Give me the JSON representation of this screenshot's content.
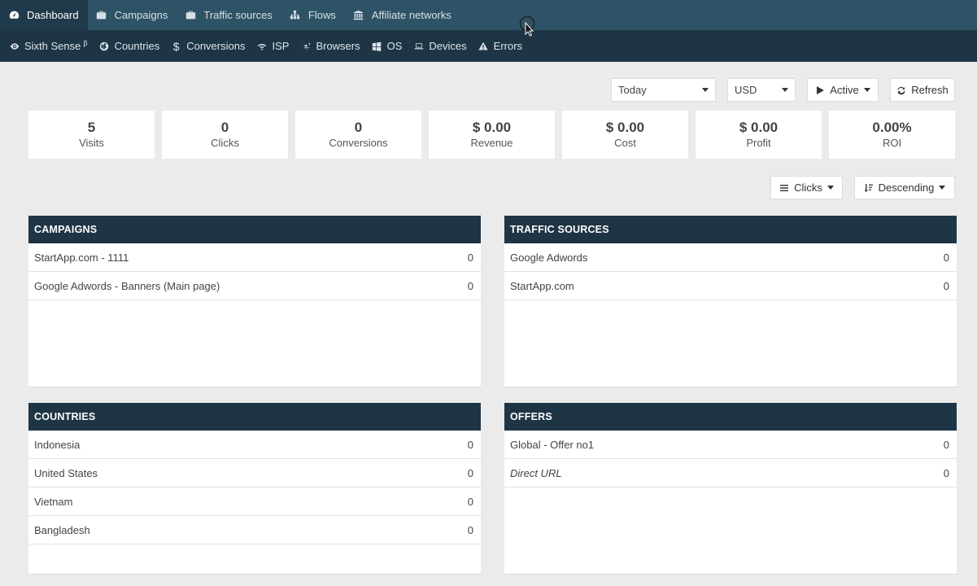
{
  "topnav": {
    "items": [
      {
        "label": "Dashboard",
        "icon": "dashboard-icon",
        "active": true
      },
      {
        "label": "Campaigns",
        "icon": "briefcase-icon"
      },
      {
        "label": "Traffic sources",
        "icon": "briefcase-icon"
      },
      {
        "label": "Flows",
        "icon": "sitemap-icon"
      },
      {
        "label": "Affiliate networks",
        "icon": "bank-icon"
      }
    ]
  },
  "subnav": {
    "items": [
      {
        "label": "Sixth Sense",
        "sup": "β",
        "icon": "eye-icon"
      },
      {
        "label": "Countries",
        "icon": "globe-icon"
      },
      {
        "label": "Conversions",
        "icon": "dollar-icon"
      },
      {
        "label": "ISP",
        "icon": "wifi-icon"
      },
      {
        "label": "Browsers",
        "icon": "browser-icon"
      },
      {
        "label": "OS",
        "icon": "windows-icon"
      },
      {
        "label": "Devices",
        "icon": "laptop-icon"
      },
      {
        "label": "Errors",
        "icon": "warning-icon"
      }
    ]
  },
  "controls": {
    "period": "Today",
    "currency": "USD",
    "status": "Active",
    "refresh": "Refresh",
    "sort_by": "Clicks",
    "sort_order": "Descending"
  },
  "stats": [
    {
      "value": "5",
      "label": "Visits"
    },
    {
      "value": "0",
      "label": "Clicks"
    },
    {
      "value": "0",
      "label": "Conversions"
    },
    {
      "value": "$ 0.00",
      "label": "Revenue"
    },
    {
      "value": "$ 0.00",
      "label": "Cost"
    },
    {
      "value": "$ 0.00",
      "label": "Profit"
    },
    {
      "value": "0.00%",
      "label": "ROI"
    }
  ],
  "panels": {
    "campaigns": {
      "title": "CAMPAIGNS",
      "rows": [
        {
          "name": "StartApp.com - 1111",
          "value": "0"
        },
        {
          "name": "Google Adwords - Banners (Main page)",
          "value": "0"
        }
      ]
    },
    "traffic_sources": {
      "title": "TRAFFIC SOURCES",
      "rows": [
        {
          "name": "Google Adwords",
          "value": "0"
        },
        {
          "name": "StartApp.com",
          "value": "0"
        }
      ]
    },
    "countries": {
      "title": "COUNTRIES",
      "rows": [
        {
          "name": "Indonesia",
          "value": "0"
        },
        {
          "name": "United States",
          "value": "0"
        },
        {
          "name": "Vietnam",
          "value": "0"
        },
        {
          "name": "Bangladesh",
          "value": "0"
        }
      ]
    },
    "offers": {
      "title": "OFFERS",
      "rows": [
        {
          "name": "Global - Offer no1",
          "value": "0"
        },
        {
          "name": "Direct URL",
          "value": "0",
          "italic": true
        }
      ]
    }
  }
}
